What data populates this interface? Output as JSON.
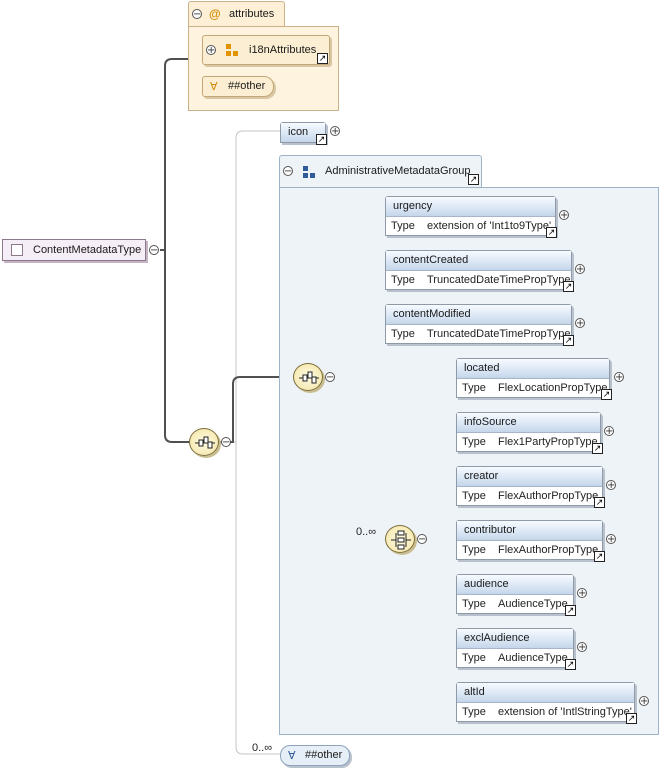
{
  "root": {
    "name": "ContentMetadataType"
  },
  "attributes": {
    "label": "attributes",
    "attr_group": "i18nAttributes",
    "any_attribute": "##other"
  },
  "icon_element": {
    "name": "icon"
  },
  "group": {
    "name": "AdministrativeMetadataGroup",
    "type_label": "Type",
    "elements": [
      {
        "name": "urgency",
        "type": "extension of 'Int1to9Type'"
      },
      {
        "name": "contentCreated",
        "type": "TruncatedDateTimePropType"
      },
      {
        "name": "contentModified",
        "type": "TruncatedDateTimePropType"
      }
    ],
    "choice_occurrence": "0..∞",
    "choice_elements": [
      {
        "name": "located",
        "type": "FlexLocationPropType"
      },
      {
        "name": "infoSource",
        "type": "Flex1PartyPropType"
      },
      {
        "name": "creator",
        "type": "FlexAuthorPropType"
      },
      {
        "name": "contributor",
        "type": "FlexAuthorPropType"
      },
      {
        "name": "audience",
        "type": "AudienceType"
      },
      {
        "name": "exclAudience",
        "type": "AudienceType"
      },
      {
        "name": "altId",
        "type": "extension of 'IntlStringType'"
      }
    ]
  },
  "any_element": {
    "occurrence": "0..∞",
    "label": "##other"
  },
  "colors": {
    "line": "#505050",
    "light_line": "#c0c0c0",
    "element_header": "#dbe7f5",
    "attributes_bg": "#fdf3df",
    "group_bg": "#eef3f8"
  }
}
